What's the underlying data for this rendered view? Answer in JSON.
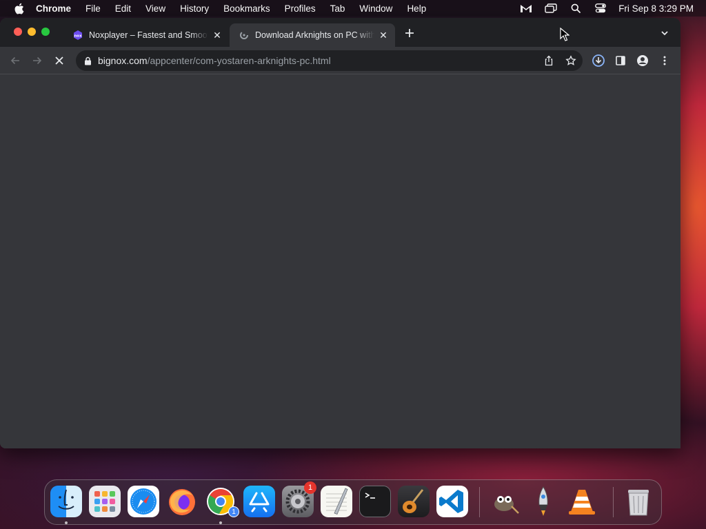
{
  "menubar": {
    "app_name": "Chrome",
    "items": [
      "File",
      "Edit",
      "View",
      "History",
      "Bookmarks",
      "Profiles",
      "Tab",
      "Window",
      "Help"
    ],
    "clock": "Fri Sep 8  3:29 PM"
  },
  "tabs": [
    {
      "title": "Noxplayer – Fastest and Smoother",
      "favicon": "noxplayer-icon",
      "active": false
    },
    {
      "title": "Download Arknights on PC with",
      "favicon": "loading-icon",
      "active": true
    }
  ],
  "toolbar": {
    "url_domain": "bignox.com",
    "url_path": "/appcenter/com-yostaren-arknights-pc.html"
  },
  "dock": {
    "apps": [
      "Finder",
      "Launchpad",
      "Safari",
      "Firefox",
      "Google Chrome",
      "App Store",
      "System Settings",
      "TextEdit",
      "Terminal",
      "GarageBand",
      "Visual Studio Code",
      "GIMP",
      "Inkscape",
      "VLC",
      "Trash"
    ],
    "chrome_badge": "1",
    "settings_badge": "1"
  },
  "colors": {
    "tabstrip": "#202124",
    "toolbar": "#35363a",
    "omnibox": "#202124",
    "accent_blue": "#8ab4f8"
  }
}
